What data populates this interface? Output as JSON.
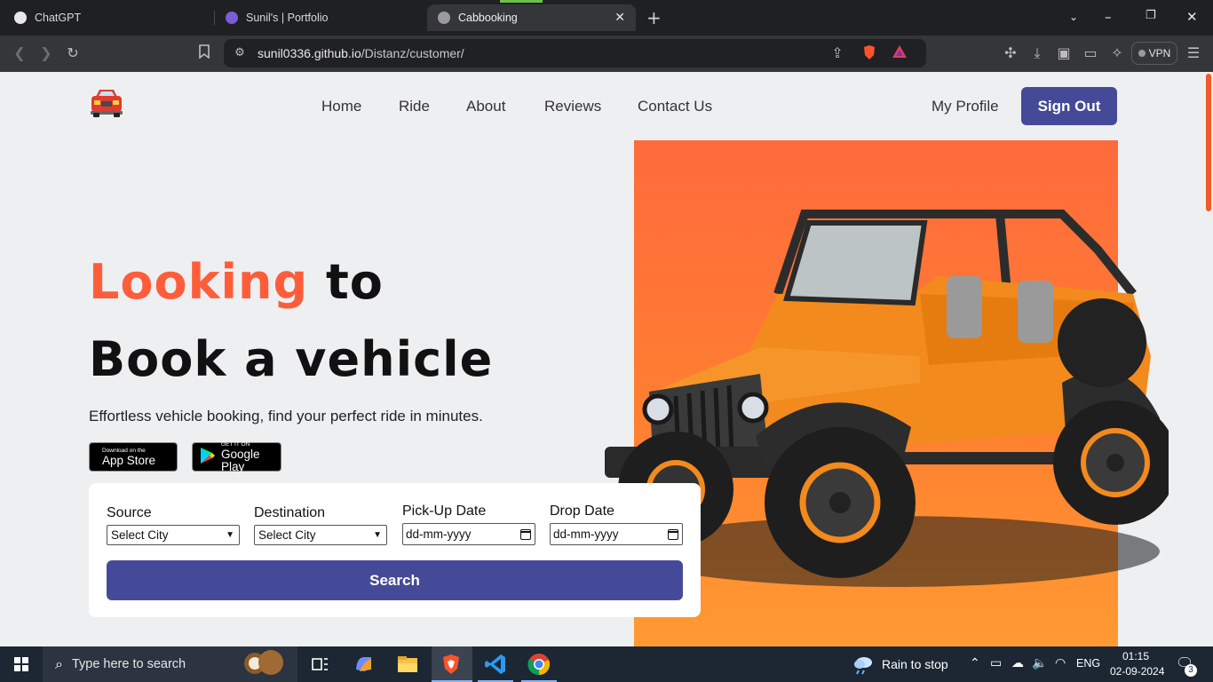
{
  "browser": {
    "tabs": [
      {
        "title": "ChatGPT",
        "icon": "chatgpt-icon"
      },
      {
        "title": "Sunil's | Portfolio",
        "icon": "portfolio-icon"
      },
      {
        "title": "Cabbooking",
        "icon": "globe-icon",
        "active": true
      }
    ],
    "url_host": "sunil0336.github.io",
    "url_path": "/Distanz/customer/",
    "vpn_label": "VPN"
  },
  "nav": {
    "links": [
      "Home",
      "Ride",
      "About",
      "Reviews",
      "Contact Us"
    ],
    "profile_label": "My Profile",
    "signout_label": "Sign Out"
  },
  "hero": {
    "headline_accent": "Looking",
    "headline_rest": " to",
    "headline_line2": "Book a vehicle",
    "tagline": "Effortless vehicle booking, find your perfect ride in minutes.",
    "appstore_small": "Download on the",
    "appstore_big": "App Store",
    "googleplay_small": "GET IT ON",
    "googleplay_big": "Google Play"
  },
  "booking": {
    "source_label": "Source",
    "source_value": "Select City",
    "destination_label": "Destination",
    "destination_value": "Select City",
    "pickup_label": "Pick-Up Date",
    "pickup_placeholder": "dd-mm-yyyy",
    "drop_label": "Drop Date",
    "drop_placeholder": "dd-mm-yyyy",
    "search_label": "Search"
  },
  "taskbar": {
    "search_placeholder": "Type here to search",
    "weather": "Rain to stop",
    "lang": "ENG",
    "time": "01:15",
    "date": "02-09-2024",
    "notifications": "3"
  },
  "colors": {
    "accent": "#ff5d3a",
    "primary_button": "#454a98",
    "hero_orange": "#ff7a33"
  }
}
